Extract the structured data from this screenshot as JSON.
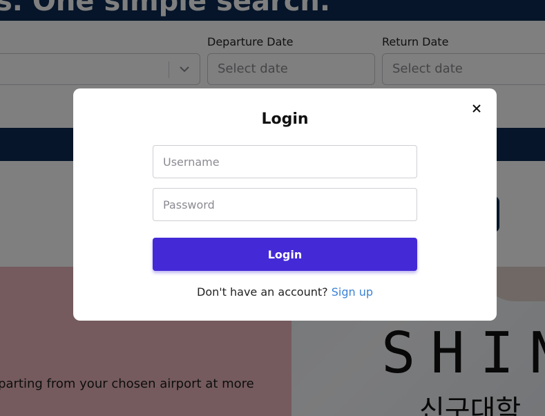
{
  "background": {
    "banner_text": "s. One simple search.",
    "form": {
      "departure_label": "Departure Date",
      "departure_placeholder": "Select date",
      "return_label": "Return Date",
      "return_placeholder": "Select date"
    },
    "promo_text": "eparting from your chosen airport at more",
    "promo_logo_word": "SHIN",
    "promo_logo_korean": "신구대학"
  },
  "modal": {
    "title": "Login",
    "username_placeholder": "Username",
    "password_placeholder": "Password",
    "login_button": "Login",
    "signup_prompt": "Don't have an account?",
    "signup_link": "Sign up",
    "close_icon": "close-icon"
  },
  "colors": {
    "navy": "#0d2a52",
    "primary_button": "#432ad6",
    "link": "#3b82d6",
    "promo_pink": "#ebb7bc"
  }
}
